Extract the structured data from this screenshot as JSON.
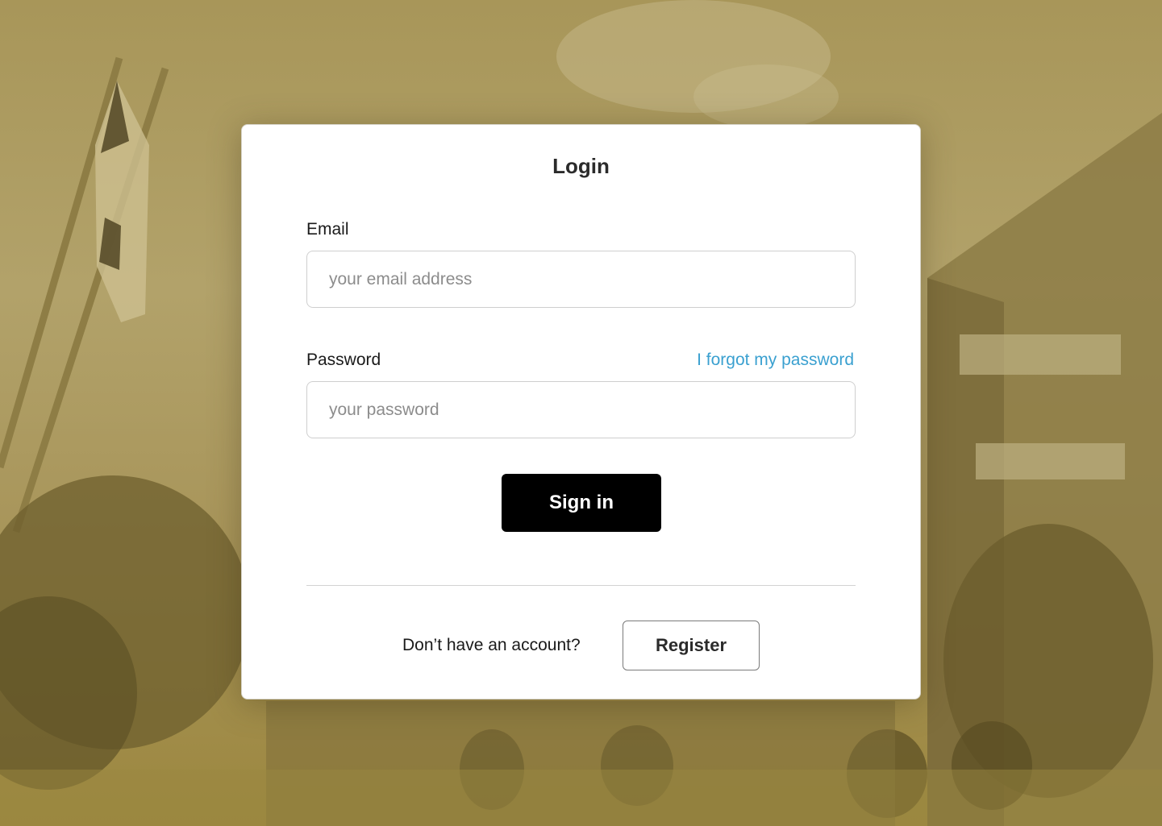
{
  "colors": {
    "background_tint": "#a89659",
    "card": "#ffffff",
    "link": "#3aa0d0",
    "primary_button": "#000000"
  },
  "login": {
    "title": "Login",
    "email": {
      "label": "Email",
      "placeholder": "your email address",
      "value": ""
    },
    "password": {
      "label": "Password",
      "placeholder": "your password",
      "value": "",
      "forgot_link": "I forgot my password"
    },
    "signin_label": "Sign in",
    "register_prompt": "Don’t have an account?",
    "register_label": "Register"
  }
}
